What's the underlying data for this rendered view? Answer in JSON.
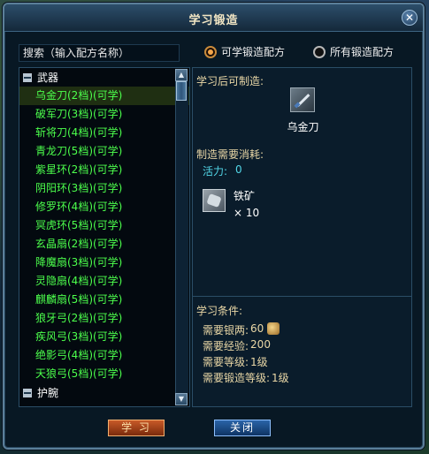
{
  "window": {
    "title": "学习锻造"
  },
  "search": {
    "label": "搜索（输入配方名称）"
  },
  "filters": [
    {
      "label": "可学锻造配方",
      "checked": true
    },
    {
      "label": "所有锻造配方",
      "checked": false
    }
  ],
  "categories": [
    {
      "name": "武器",
      "expanded": true,
      "items": [
        "乌金刀(2档)(可学)",
        "破军刀(3档)(可学)",
        "斩将刀(4档)(可学)",
        "青龙刀(5档)(可学)",
        "紫星环(2档)(可学)",
        "阴阳环(3档)(可学)",
        "修罗环(4档)(可学)",
        "冥虎环(5档)(可学)",
        "玄晶扇(2档)(可学)",
        "降魔扇(3档)(可学)",
        "灵隐扇(4档)(可学)",
        "麒麟扇(5档)(可学)",
        "狼牙弓(2档)(可学)",
        "疾风弓(3档)(可学)",
        "绝影弓(4档)(可学)",
        "天狼弓(5档)(可学)"
      ]
    },
    {
      "name": "护腕",
      "expanded": false,
      "items": []
    }
  ],
  "selected_item_index": 0,
  "detail": {
    "can_make_label": "学习后可制造:",
    "product_name": "乌金刀",
    "product_icon": "blade-icon",
    "cost_label": "制造需要消耗:",
    "vitality_label": "活力:",
    "vitality_value": "0",
    "material_name": "铁矿",
    "material_icon": "iron-ore-icon",
    "material_count": "× 10",
    "conditions_label": "学习条件:",
    "conditions": [
      {
        "label": "需要银两:",
        "value": "60",
        "icon": "silver-icon"
      },
      {
        "label": "需要经验:",
        "value": "200"
      },
      {
        "label": "需要等级:",
        "value": "1级"
      },
      {
        "label": "需要锻造等级:",
        "value": "1级"
      }
    ]
  },
  "buttons": {
    "learn": "学 习",
    "close": "关闭"
  },
  "colors": {
    "item_green": "#4cff4c",
    "label_gold": "#e9d7a6",
    "value_cyan": "#52d7e8"
  }
}
